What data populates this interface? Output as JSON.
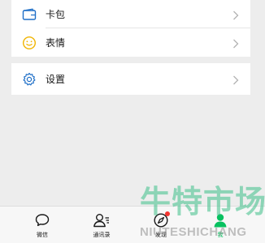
{
  "menu": {
    "cards_label": "卡包",
    "stickers_label": "表情",
    "settings_label": "设置"
  },
  "tabbar": {
    "chats_label": "微信",
    "contacts_label": "通讯录",
    "discover_label": "发现",
    "me_label": "我"
  },
  "watermark": {
    "chinese_text": "牛特市场",
    "pinyin_text": "NIUTESHICHANG"
  },
  "colors": {
    "accent_green": "#07c160",
    "icon_blue": "#1f6fc7",
    "sticker_yellow": "#f0b400",
    "badge_red": "#f43530",
    "background": "#ededed"
  }
}
